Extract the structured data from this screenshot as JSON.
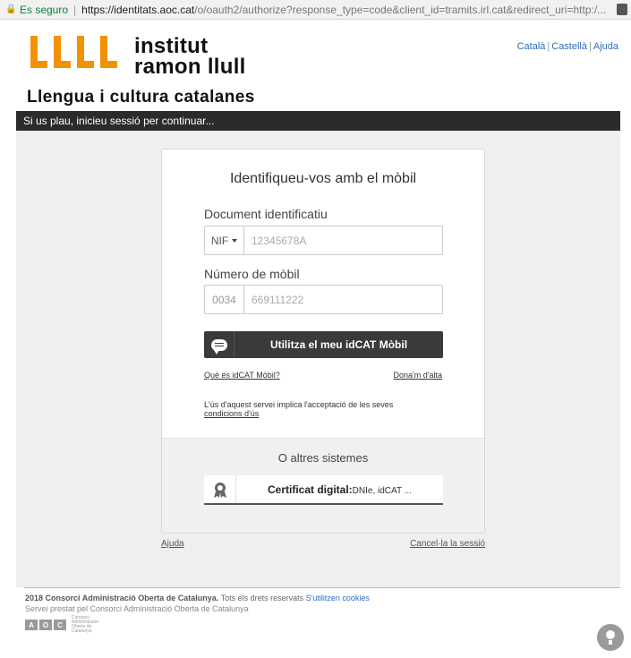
{
  "browser": {
    "secure_label": "Es seguro",
    "url_host": "https://identitats.aoc.cat",
    "url_path": "/o/oauth2/authorize?response_type=code&client_id=tramits.irl.cat&redirect_uri=http:/..."
  },
  "header": {
    "logo_line1": "institut",
    "logo_line2": "ramon llull",
    "tagline": "Llengua i cultura catalanes",
    "lang_ca": "Català",
    "lang_es": "Castellà",
    "help": "Ajuda",
    "banner": "Si us plau, inicieu sessió per continuar..."
  },
  "login": {
    "title": "Identifiqueu-vos amb el mòbil",
    "doc_label": "Document identificatiu",
    "doc_type": "NIF",
    "doc_placeholder": "12345678A",
    "phone_label": "Número de mòbil",
    "phone_prefix": "0034",
    "phone_placeholder": "669111222",
    "mobil_button": "Utilitza el meu idCAT Mòbil",
    "what_link": "Què és idCAT Mòbil?",
    "signup_link": "Dona'm d'alta",
    "terms_text": "L'ús d'aquest servei implica l'acceptació de les seves",
    "terms_link": "condicions d'ús",
    "other_title": "O altres sistemes",
    "cert_bold": "Certificat digital:",
    "cert_rest": "DNIe, idCAT ..."
  },
  "below": {
    "help": "Ajuda",
    "cancel": "Cancel·la la sessió"
  },
  "footer": {
    "copyright": "2018 Consorci Administració Oberta de Catalunya.",
    "rights": "Tots els drets reservats",
    "cookies": "S'utilitzen cookies",
    "service": "Servei prestat pel Consorci Administració Oberta de Catalunya",
    "aoc_a": "A",
    "aoc_o": "O",
    "aoc_c": "C",
    "aoc_small": "Consorci Administració Oberta de Catalunya"
  },
  "colors": {
    "brand_orange": "#f39200",
    "dark_bar": "#2b2b2b",
    "link_blue": "#2a6ebb"
  }
}
